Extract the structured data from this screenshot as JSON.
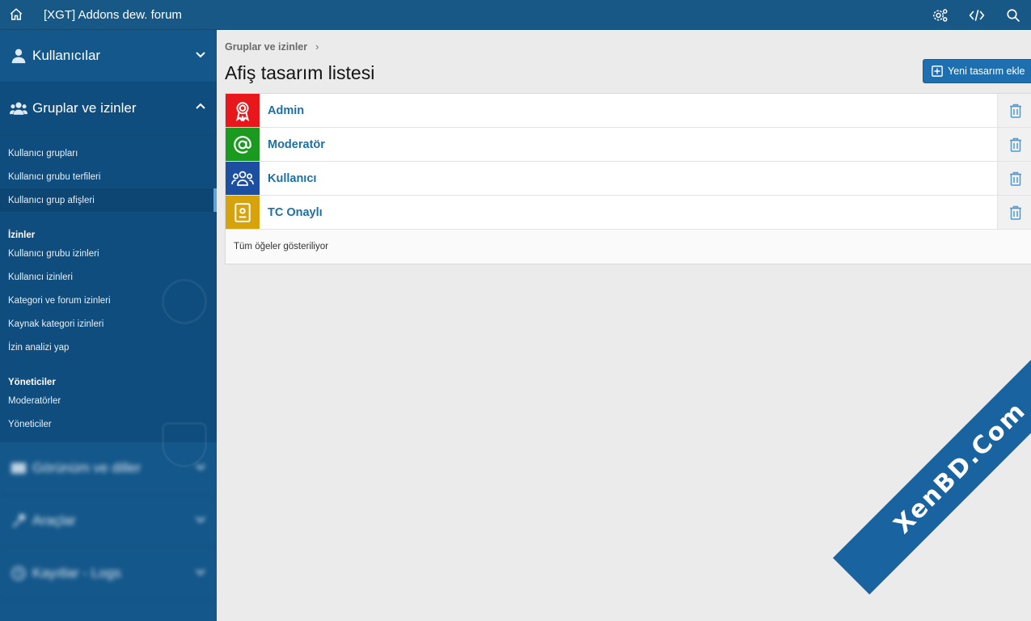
{
  "app": {
    "title": "[XGT] Addons dew. forum"
  },
  "sidebar": {
    "sections": [
      {
        "label": "Kullanıcılar"
      },
      {
        "label": "Gruplar ve izinler"
      }
    ],
    "groups_items": [
      {
        "label": "Kullanıcı grupları"
      },
      {
        "label": "Kullanıcı grubu terfileri"
      },
      {
        "label": "Kullanıcı grup afişleri"
      }
    ],
    "permissions": {
      "heading": "İzinler",
      "items": [
        {
          "label": "Kullanıcı grubu izinleri"
        },
        {
          "label": "Kullanıcı izinleri"
        },
        {
          "label": "Kategori ve forum izinleri"
        },
        {
          "label": "Kaynak kategori izinleri"
        },
        {
          "label": "İzin analizi yap"
        }
      ]
    },
    "managers": {
      "heading": "Yöneticiler",
      "items": [
        {
          "label": "Moderatörler"
        },
        {
          "label": "Yöneticiler"
        }
      ]
    },
    "collapsed_sections": [
      {
        "label": "Görünüm ve diller"
      },
      {
        "label": "Araçlar"
      },
      {
        "label": "Kayıtlar - Logs"
      }
    ]
  },
  "breadcrumb": {
    "label": "Gruplar ve izinler"
  },
  "page": {
    "title": "Afiş tasarım listesi",
    "add_button": "Yeni tasarım ekle"
  },
  "banners": [
    {
      "name": "Admin",
      "color": "#e8171b",
      "icon": "award-icon"
    },
    {
      "name": "Moderatör",
      "color": "#1a9a1f",
      "icon": "at-icon"
    },
    {
      "name": "Kullanıcı",
      "color": "#1c4fa0",
      "icon": "users-icon"
    },
    {
      "name": "TC Onaylı",
      "color": "#d6a30c",
      "icon": "id-badge-icon"
    }
  ],
  "list_footer": "Tüm öğeler gösteriliyor",
  "watermark": "XenBD.Com"
}
